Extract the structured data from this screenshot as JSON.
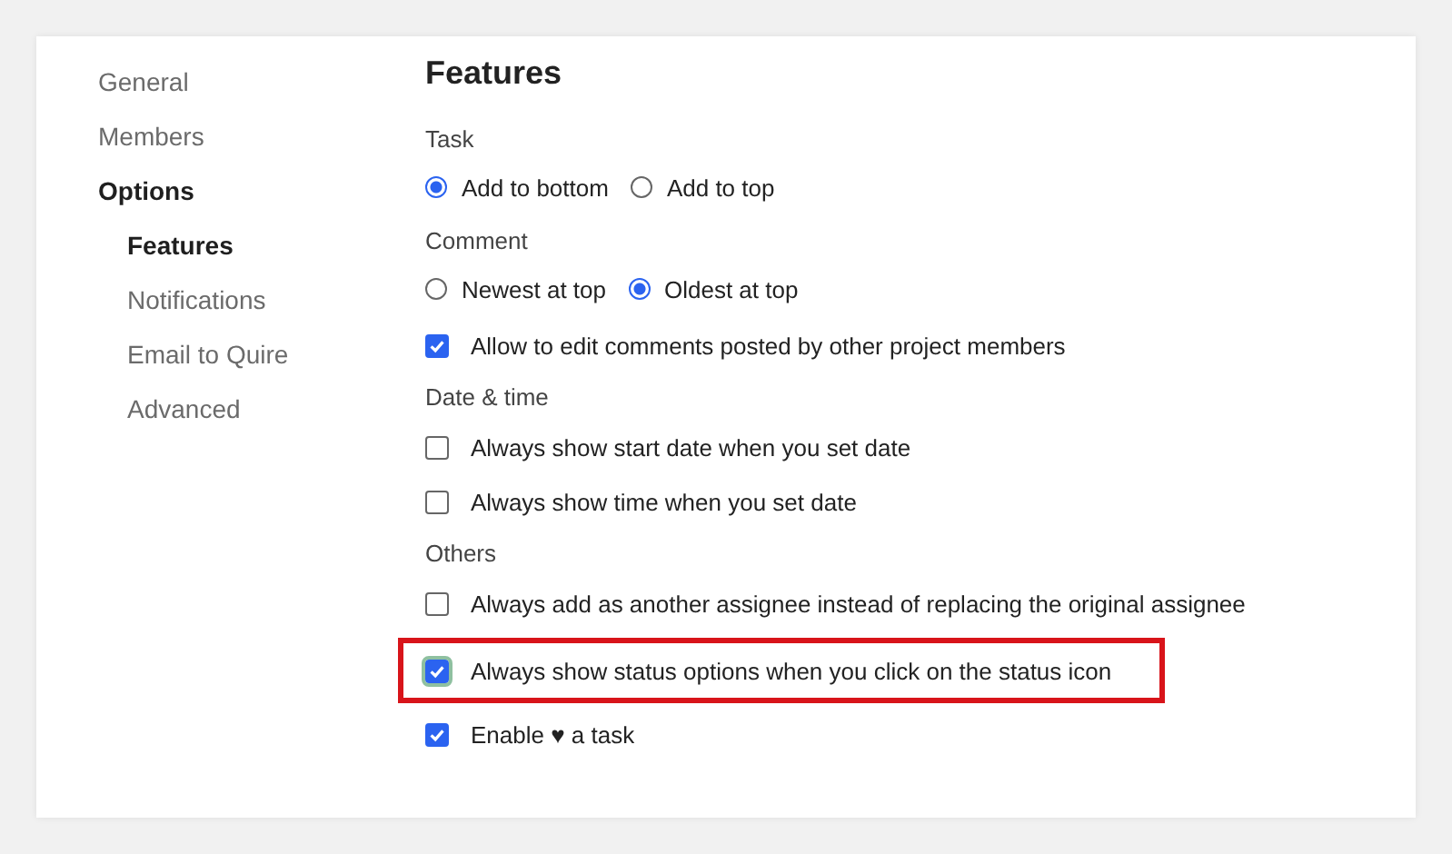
{
  "sidebar": {
    "items": [
      {
        "label": "General",
        "selected": false
      },
      {
        "label": "Members",
        "selected": false
      },
      {
        "label": "Options",
        "selected": true,
        "children": [
          {
            "label": "Features",
            "selected": true
          },
          {
            "label": "Notifications",
            "selected": false
          },
          {
            "label": "Email to Quire",
            "selected": false
          },
          {
            "label": "Advanced",
            "selected": false
          }
        ]
      }
    ]
  },
  "page_title": "Features",
  "sections": [
    {
      "title": "Task",
      "rows": [
        {
          "kind": "radio-group",
          "options": [
            {
              "label": "Add to bottom",
              "selected": true
            },
            {
              "label": "Add to top",
              "selected": false
            }
          ]
        }
      ]
    },
    {
      "title": "Comment",
      "rows": [
        {
          "kind": "radio-group",
          "options": [
            {
              "label": "Newest at top",
              "selected": false
            },
            {
              "label": "Oldest at top",
              "selected": true
            }
          ]
        },
        {
          "kind": "checkbox",
          "label": "Allow to edit comments posted by other project members",
          "checked": true,
          "highlighted": false
        }
      ]
    },
    {
      "title": "Date & time",
      "rows": [
        {
          "kind": "checkbox",
          "label": "Always show start date when you set date",
          "checked": false,
          "highlighted": false
        },
        {
          "kind": "checkbox",
          "label": "Always show time when you set date",
          "checked": false,
          "highlighted": false
        }
      ]
    },
    {
      "title": "Others",
      "rows": [
        {
          "kind": "checkbox",
          "label": "Always add as another assignee instead of replacing the original assignee",
          "checked": false,
          "highlighted": false
        },
        {
          "kind": "checkbox",
          "label": "Always show status options when you click on the status icon",
          "checked": true,
          "highlighted": true
        },
        {
          "kind": "checkbox",
          "label": "Enable ♥ a task",
          "checked": true,
          "highlighted": false
        }
      ]
    }
  ]
}
